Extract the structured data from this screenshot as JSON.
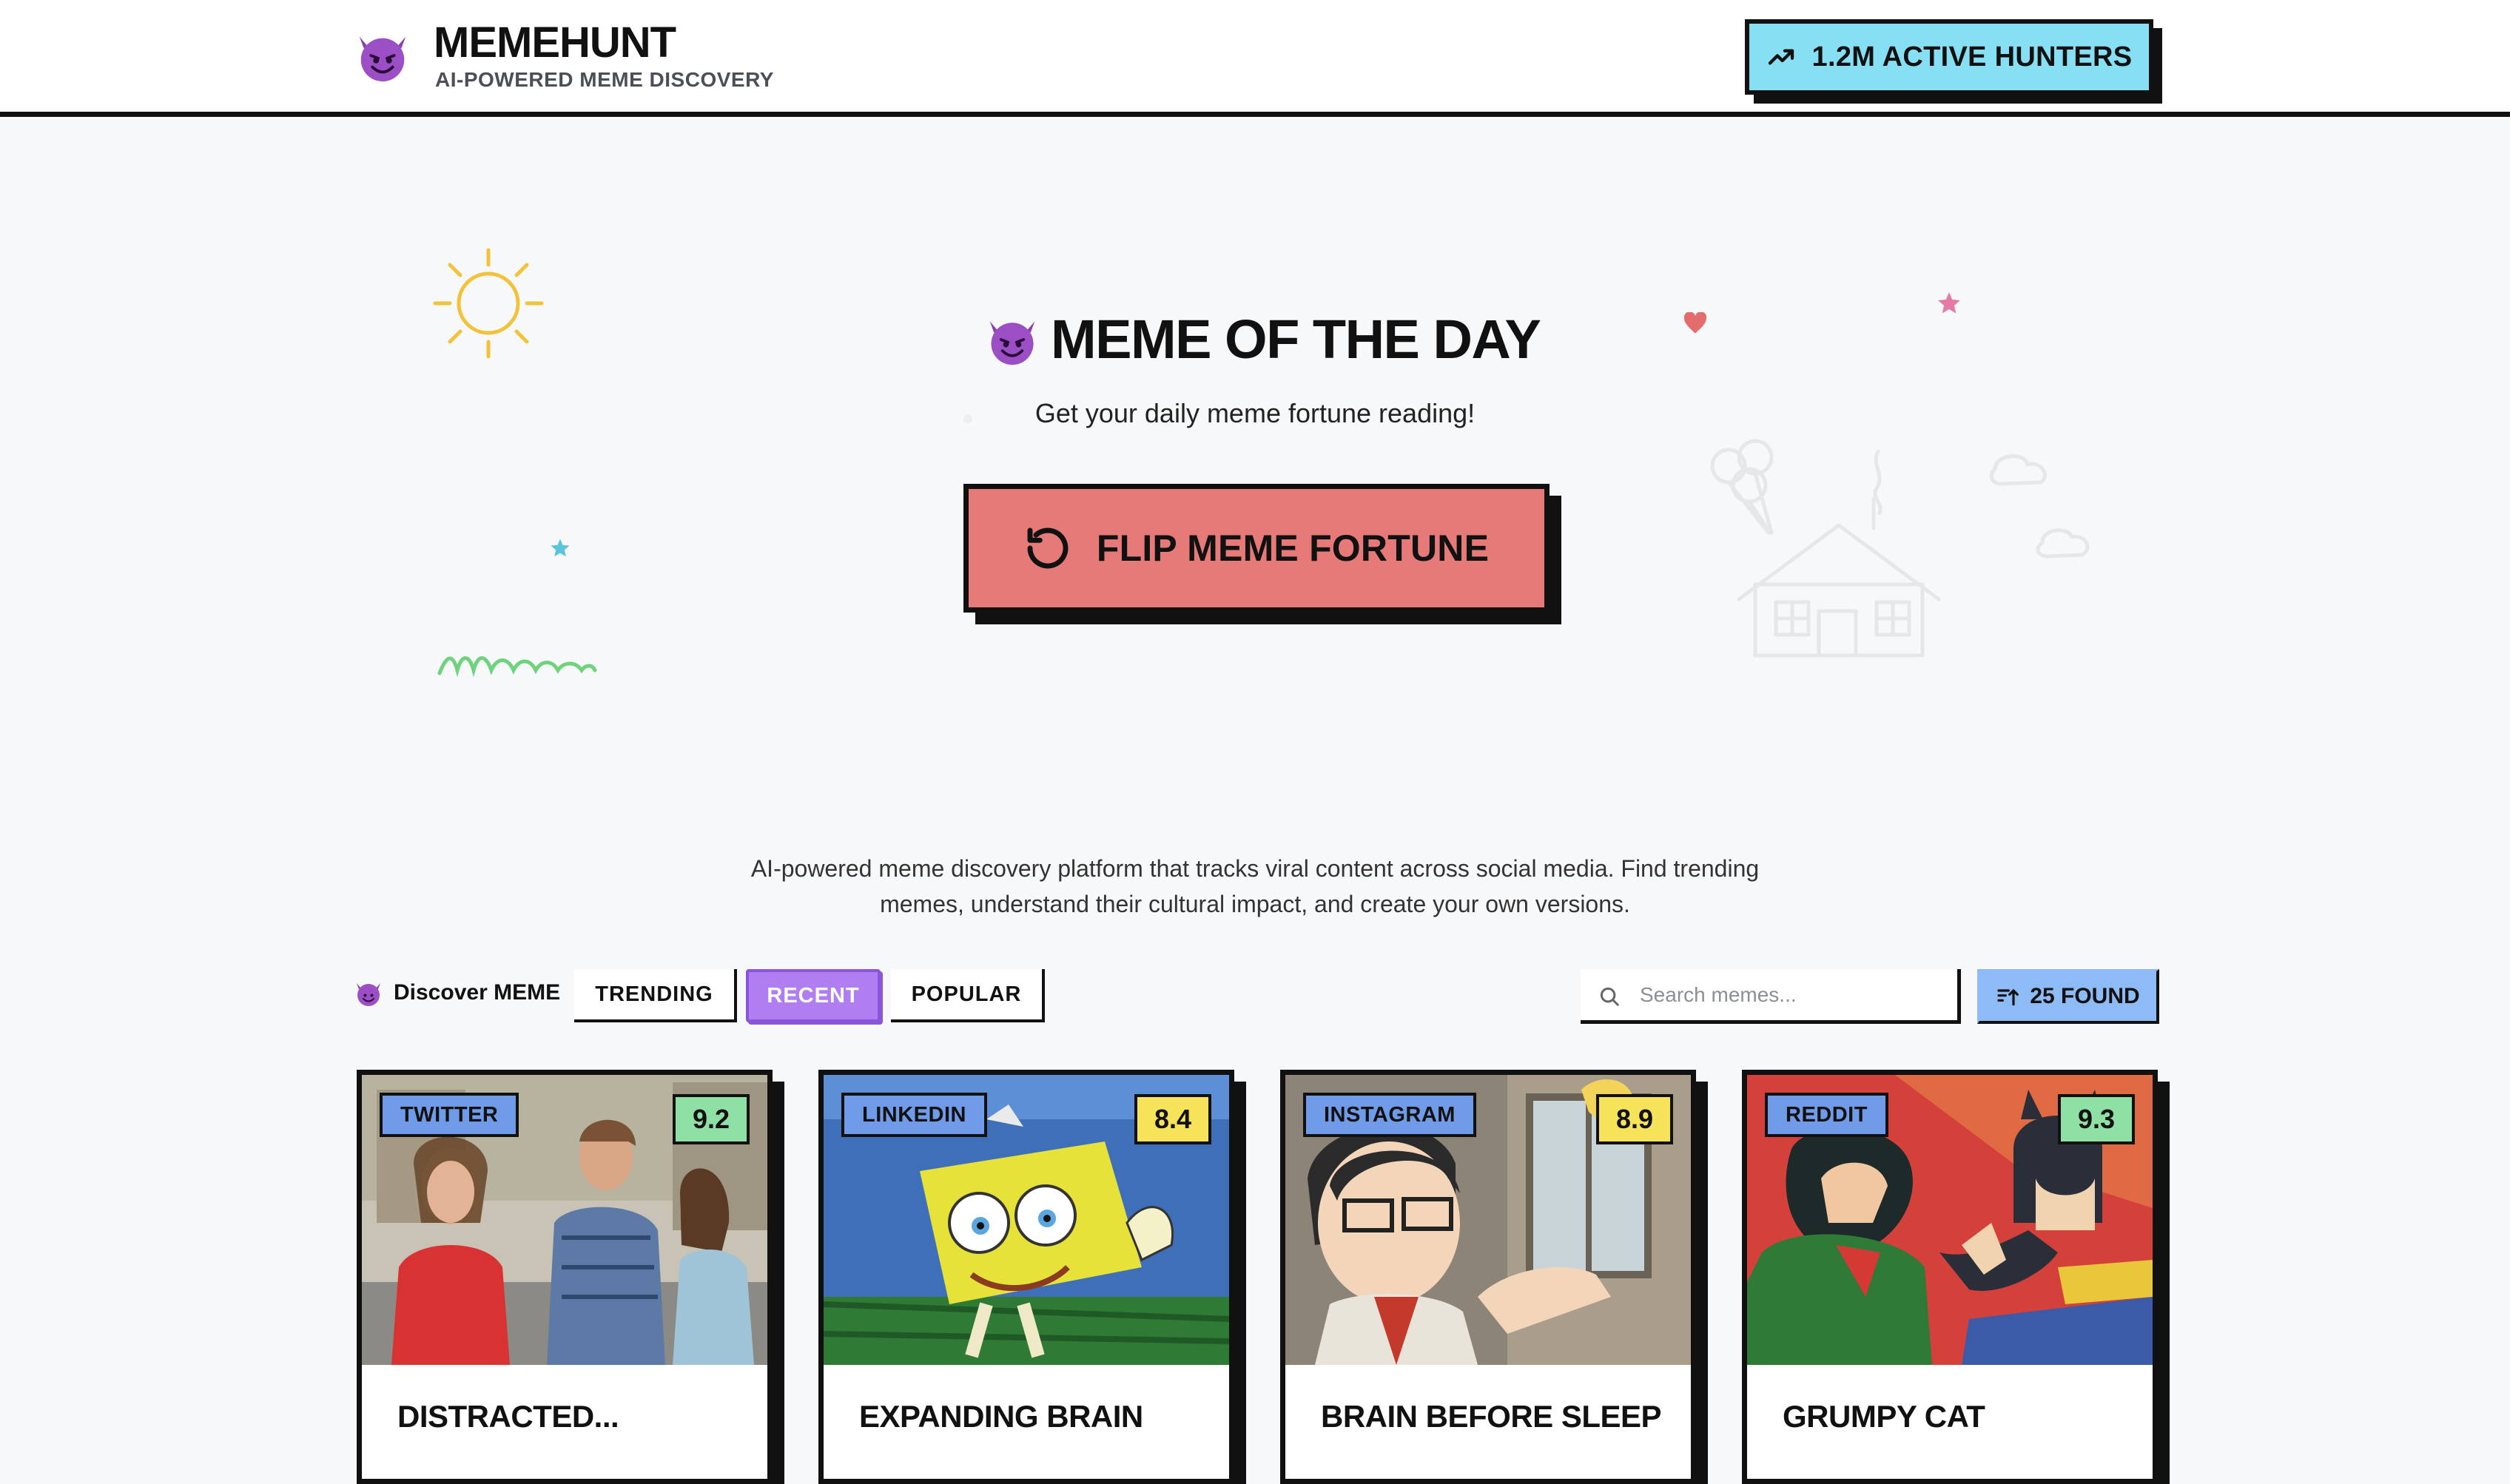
{
  "header": {
    "logo_title": "MEMEHUNT",
    "logo_subtitle": "AI-POWERED MEME DISCOVERY",
    "logo_icon": "smiling-devil-icon",
    "hunters_label": "1.2M ACTIVE HUNTERS",
    "hunters_icon": "trending-up-icon"
  },
  "hero": {
    "title": "MEME OF THE DAY",
    "subtitle": "Get your daily meme fortune reading!",
    "flip_label": "FLIP MEME FORTUNE",
    "flip_icon": "rotate-ccw-icon"
  },
  "description": "AI-powered meme discovery platform that tracks viral content across social media. Find trending memes, understand their cultural impact, and create your own versions.",
  "toolbar": {
    "discover_label": "Discover MEME",
    "tabs": [
      {
        "label": "TRENDING",
        "active": false
      },
      {
        "label": "RECENT",
        "active": true
      },
      {
        "label": "POPULAR",
        "active": false
      }
    ],
    "search_placeholder": "Search memes...",
    "found_label": "25 FOUND",
    "found_icon": "sort-icon"
  },
  "cards": [
    {
      "platform": "TWITTER",
      "score": "9.2",
      "title": "DISTRACTED...",
      "score_color": "#8fe0a5"
    },
    {
      "platform": "LINKEDIN",
      "score": "8.4",
      "title": "EXPANDING BRAIN",
      "score_color": "#f7e35a"
    },
    {
      "platform": "INSTAGRAM",
      "score": "8.9",
      "title": "BRAIN BEFORE SLEEP",
      "score_color": "#f7e35a"
    },
    {
      "platform": "REDDIT",
      "score": "9.3",
      "title": "GRUMPY CAT",
      "score_color": "#8fe0a5"
    }
  ],
  "colors": {
    "accent_cyan": "#86dff2",
    "flip_red": "#e57a78",
    "tab_active": "#b07ef0",
    "found_blue": "#8dbbf5",
    "platform_blue": "#6f9be8"
  }
}
